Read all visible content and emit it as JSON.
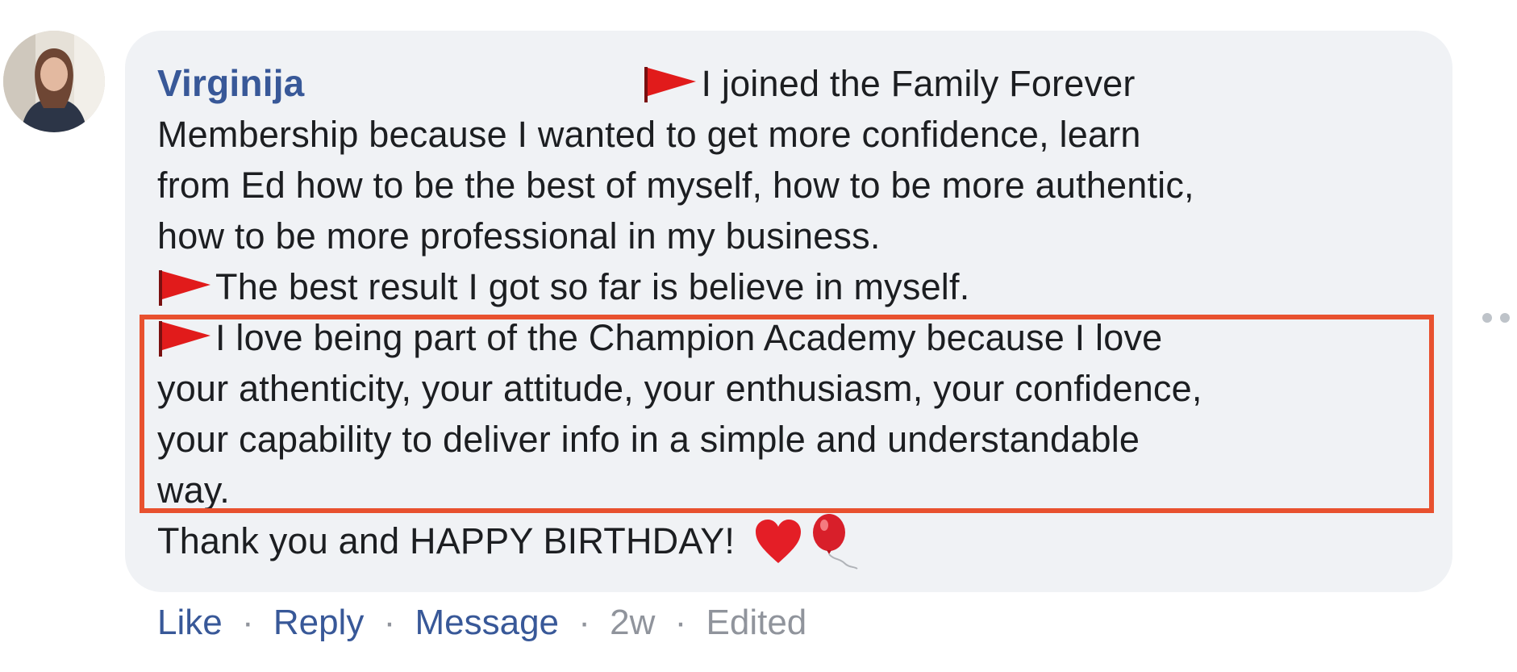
{
  "comment": {
    "author": "Virginija",
    "lines": {
      "l1": "I joined the Family Forever",
      "l2": "Membership because I wanted to get more confidence, learn",
      "l3": "from Ed how to be the best of myself, how to be more authentic,",
      "l4": "how to be more professional in my business.",
      "l5": "The best result I got so far is believe in myself.",
      "l6": "I love being part of the Champion Academy because I love",
      "l7": "your athenticity, your attitude, your enthusiasm, your confidence,",
      "l8": "your capability to deliver info in a simple and understandable",
      "l9": "way.",
      "l10": "Thank you and HAPPY BIRTHDAY!"
    },
    "icons": {
      "flag": "red-triangular-flag-icon",
      "heart": "red-heart-icon",
      "balloon": "balloon-icon"
    }
  },
  "actions": {
    "like": "Like",
    "reply": "Reply",
    "message": "Message",
    "time": "2w",
    "edited": "Edited",
    "separator": "·"
  },
  "colors": {
    "link": "#385898",
    "bubble": "#f0f2f5",
    "highlight": "#e8512f",
    "meta": "#90949c"
  }
}
